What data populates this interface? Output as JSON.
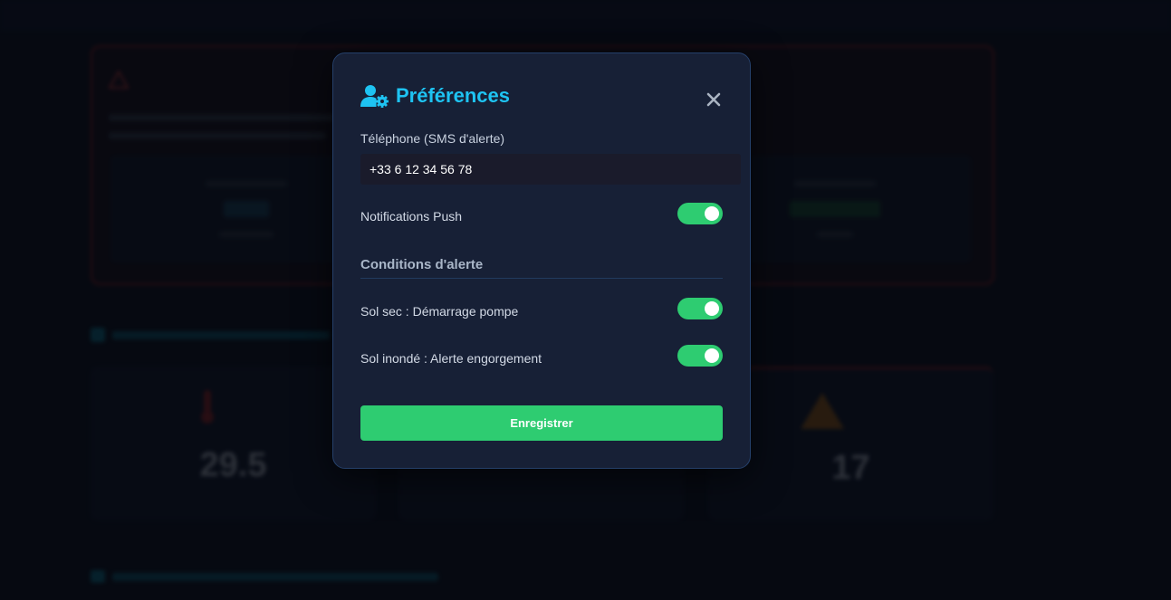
{
  "modal": {
    "title": "Préférences",
    "title_icon": "user-settings-icon",
    "close_icon": "close-icon",
    "phone": {
      "label": "Téléphone (SMS d'alerte)",
      "value": "+33 6 12 34 56 78"
    },
    "push": {
      "label": "Notifications Push",
      "enabled": true
    },
    "conditions": {
      "title": "Conditions d'alerte",
      "items": [
        {
          "label": "Sol sec : Démarrage pompe",
          "enabled": true
        },
        {
          "label": "Sol inondé : Alerte engorgement",
          "enabled": true
        }
      ]
    },
    "save_label": "Enregistrer"
  },
  "colors": {
    "accent": "#1ec3f2",
    "toggle_on": "#2ecc71",
    "modal_bg": "#172036",
    "page_bg": "#0a0e17"
  },
  "background": {
    "cards": [
      {
        "value": "29.5"
      },
      {
        "value": "17"
      }
    ]
  }
}
